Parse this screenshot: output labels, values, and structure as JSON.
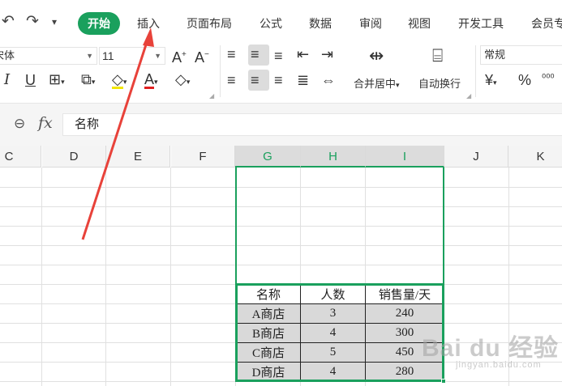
{
  "quick_access": {
    "undo_icon": "undo-icon",
    "redo_icon": "redo-icon",
    "more_icon": "chevron-down-icon"
  },
  "tabs": [
    {
      "label": "开始",
      "active": true
    },
    {
      "label": "插入",
      "active": false
    },
    {
      "label": "页面布局",
      "active": false
    },
    {
      "label": "公式",
      "active": false
    },
    {
      "label": "数据",
      "active": false
    },
    {
      "label": "审阅",
      "active": false
    },
    {
      "label": "视图",
      "active": false
    },
    {
      "label": "开发工具",
      "active": false
    },
    {
      "label": "会员专",
      "active": false
    }
  ],
  "ribbon": {
    "font_name": "宋体",
    "font_size": "11",
    "grow_font": "A⁺",
    "shrink_font": "A⁻",
    "merge_center_label": "合并居中",
    "wrap_text_label": "自动换行",
    "number_format": "常规",
    "currency_symbol": "¥",
    "percent_symbol": "%"
  },
  "formula_bar": {
    "fx_label": "fx",
    "content": "名称"
  },
  "columns": [
    "C",
    "D",
    "E",
    "F",
    "G",
    "H",
    "I",
    "J",
    "K"
  ],
  "selected_columns": [
    "G",
    "H",
    "I"
  ],
  "table": {
    "headers": [
      "名称",
      "人数",
      "销售量/天"
    ],
    "rows": [
      [
        "A商店",
        "3",
        "240"
      ],
      [
        "B商店",
        "4",
        "300"
      ],
      [
        "C商店",
        "5",
        "450"
      ],
      [
        "D商店",
        "4",
        "280"
      ]
    ]
  },
  "colors": {
    "accent": "#1aa05d",
    "arrow": "#e8423a",
    "selected_fill": "#d9d9d9"
  },
  "watermark": {
    "brand": "Bai du 经验",
    "url": "jingyan.baidu.com"
  }
}
